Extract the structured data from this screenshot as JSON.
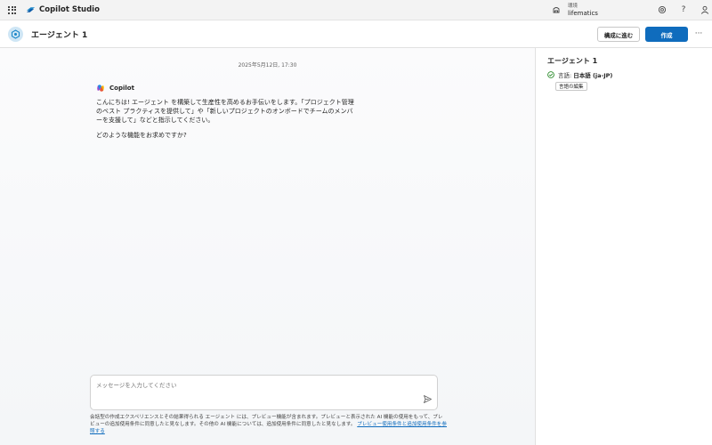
{
  "topbar": {
    "app_name": "Copilot Studio",
    "environment_label": "環境",
    "environment_name": "lifematics",
    "icons": [
      "app-launcher-icon",
      "copilot-studio-logo-icon",
      "environment-icon",
      "settings-icon",
      "help-icon",
      "account-icon"
    ]
  },
  "header": {
    "title": "エージェント 1",
    "configure_label": "構成に進む",
    "create_label": "作成",
    "more_label": "···"
  },
  "chat": {
    "timestamp": "2025年5月12日, 17:30",
    "bot_name": "Copilot",
    "message": "こんにちは! エージェント を構築して生産性を高めるお手伝いをします。「プロジェクト管理のベスト プラクティスを提供して」や「新しいプロジェクトのオンボードでチームのメンバーを支援して」などと指示してください。",
    "question": "どのような機能をお求めですか?",
    "input_placeholder": "メッセージを入力してください",
    "disclaimer_text": "会話型の作成エクスペリエンスとその結果得られる エージェント には、プレビュー機能が含まれます。プレビューと表示された AI 機能の使用をもって、プレビューの追加使用条件に同意したと見なします。その他の AI 機能については、追加使用条件に同意したと見なします。",
    "disclaimer_link": "プレビュー使用条件と追加使用条件を参照する"
  },
  "side_panel": {
    "title": "エージェント 1",
    "language_label": "言語:",
    "language_value": "日本語 (ja-JP)",
    "edit_language_label": "言語の編集"
  },
  "colors": {
    "accent": "#0f6cbd",
    "success": "#107c10"
  }
}
